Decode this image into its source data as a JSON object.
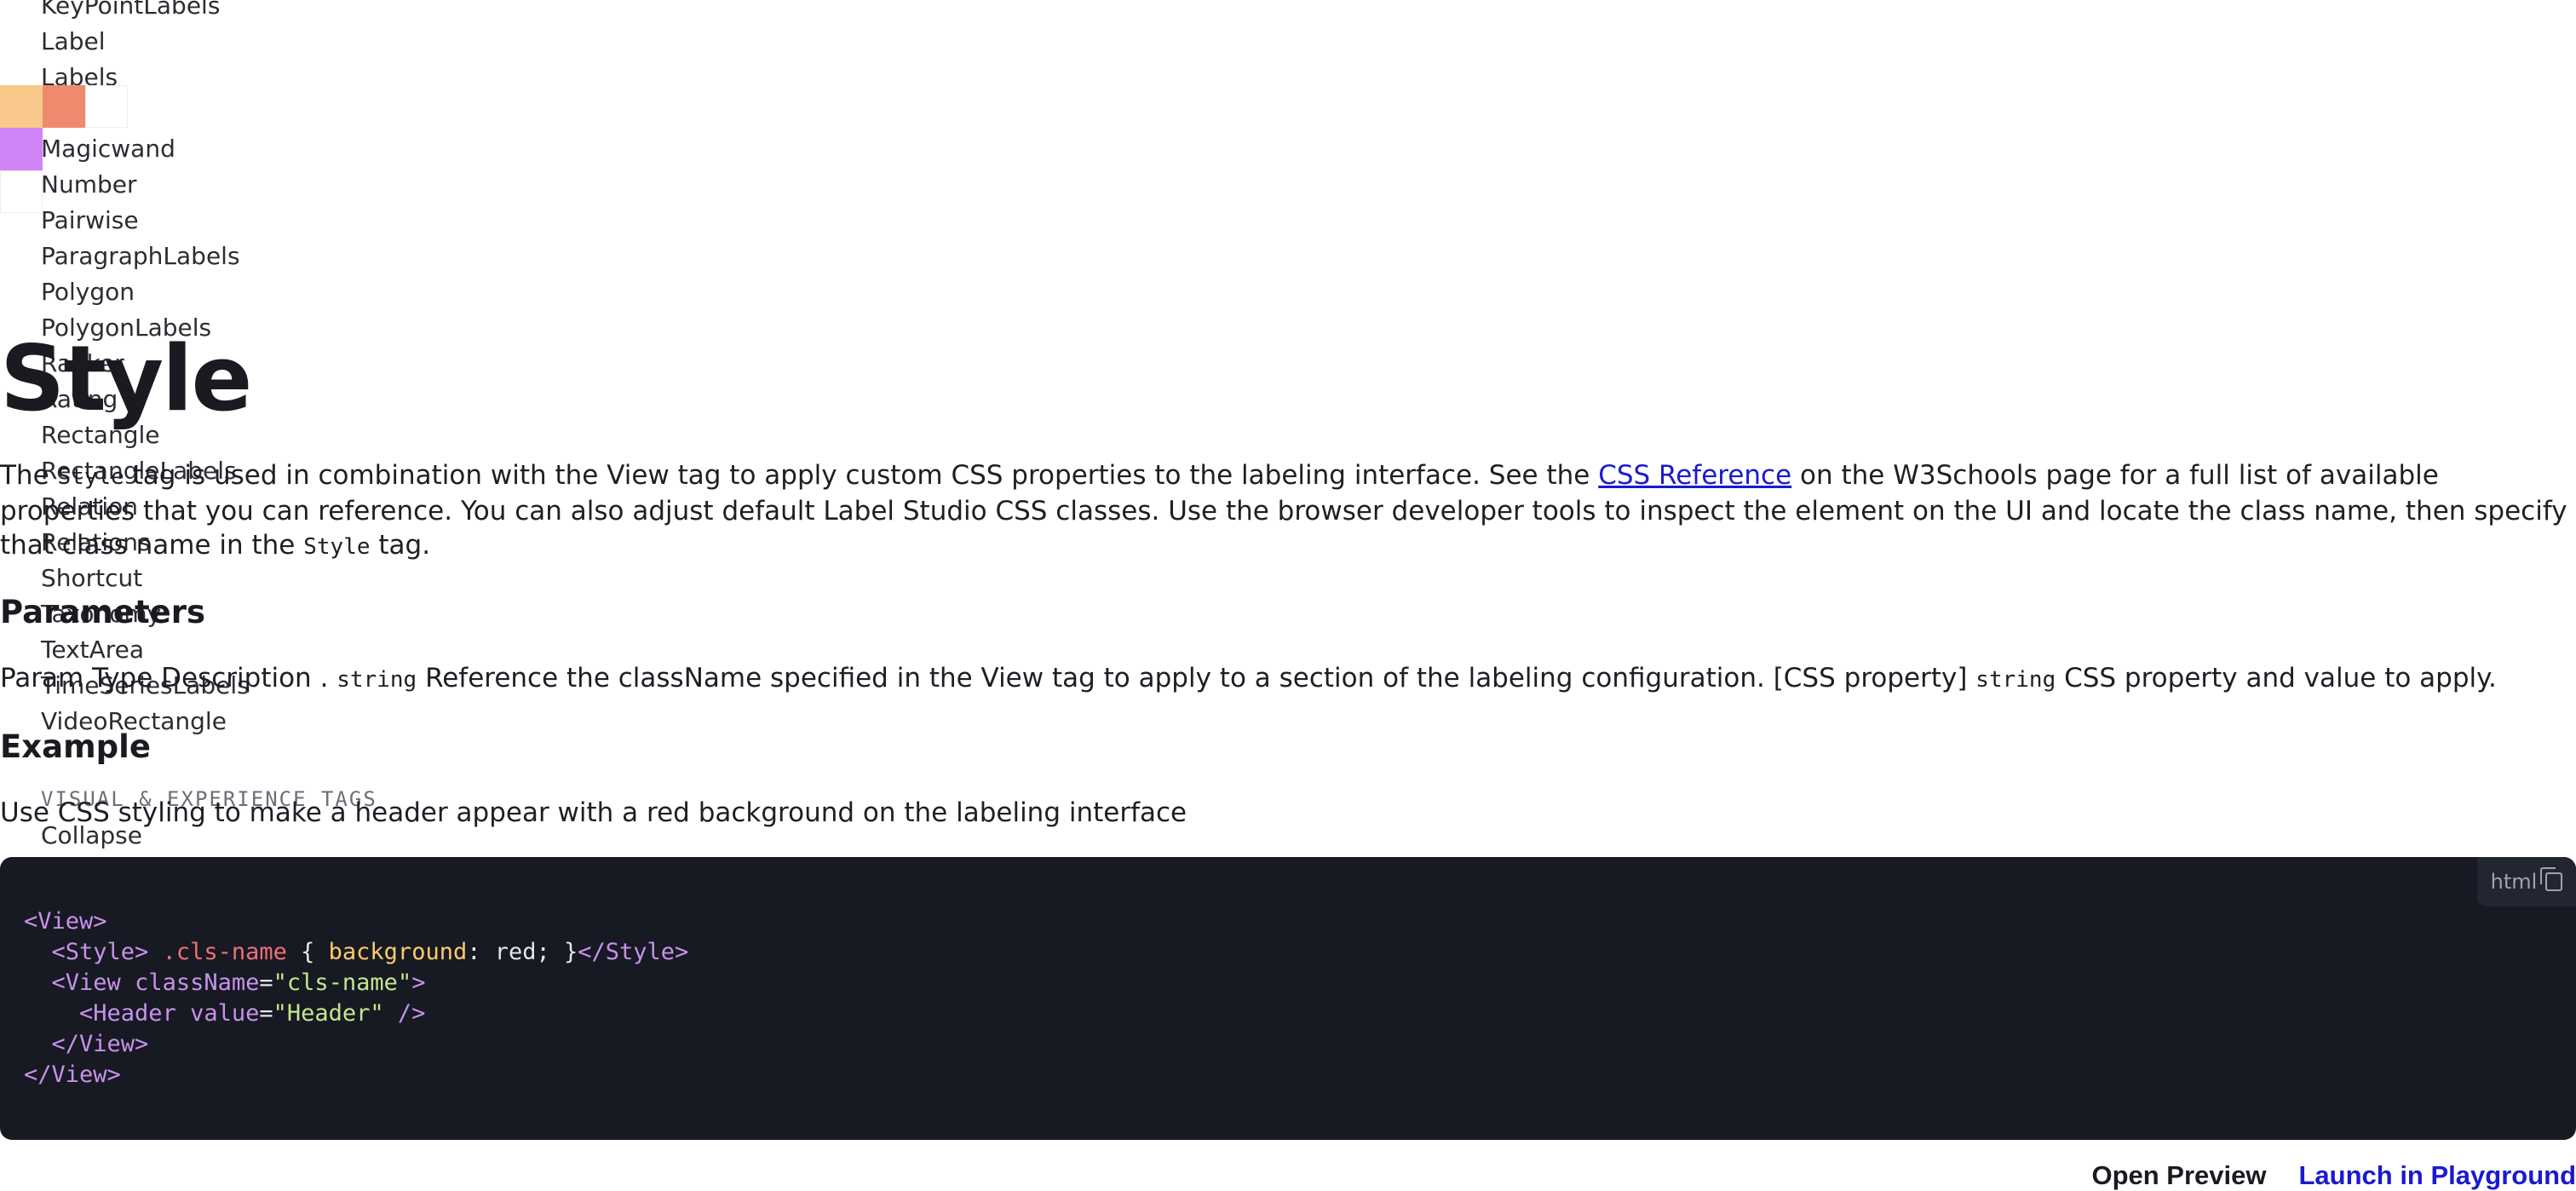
{
  "sidebar": {
    "items": [
      "KeyPointLabels",
      "Label",
      "Labels",
      "",
      "Magicwand",
      "Number",
      "Pairwise",
      "ParagraphLabels",
      "Polygon",
      "PolygonLabels",
      "Ranker",
      "Rating",
      "Rectangle",
      "RectangleLabels",
      "Relation",
      "Relations",
      "Shortcut",
      "Taxonomy",
      "TextArea",
      "TimeSeriesLabels",
      "VideoRectangle"
    ],
    "section_heading": "VISUAL & EXPERIENCE TAGS",
    "collapse_item": "Collapse"
  },
  "swatch_colors": [
    "#f8c98a",
    "#f08a6e",
    "#ffffff",
    "#cf85f5",
    "#ffffff"
  ],
  "page": {
    "title": "Style",
    "intro_part1": "The ",
    "intro_code1": "Style",
    "intro_part2": " tag is used in combination with the View tag to apply custom CSS properties to the labeling interface. See the ",
    "intro_link": "CSS Reference",
    "intro_part3": " on the W3Schools page for a full list of available properties that you can reference. You can also adjust default Label Studio CSS classes. Use the browser developer tools to inspect the element on the UI and locate the class name, then specify that class name in the ",
    "intro_code2": "Style",
    "intro_part4": " tag.",
    "params_heading": "Parameters",
    "params_header": "Param Type Description",
    "param1_name": ".",
    "param1_type": "string",
    "param1_desc": "Reference the className specified in the View tag to apply to a section of the labeling configuration.",
    "param2_name": "[CSS property]",
    "param2_type": "string",
    "param2_desc": "CSS property and value to apply.",
    "example_heading": "Example",
    "example_desc": "Use CSS styling to make a header appear with a red background on the labeling interface"
  },
  "code": {
    "language": "html",
    "line1_open": "<View>",
    "line2_open": "<Style>",
    "line2_sel": " .cls-name",
    "line2_brace_open": " { ",
    "line2_prop": "background",
    "line2_val": ": red; }",
    "line2_close": "</Style>",
    "line3_open": "<View ",
    "line3_attr": "className",
    "line3_eq": "=",
    "line3_str": "\"cls-name\"",
    "line3_end": ">",
    "line4_open": "<Header ",
    "line4_attr": "value",
    "line4_eq": "=",
    "line4_str": "\"Header\"",
    "line4_end": " />",
    "line5_close": "</View>",
    "line6_close": "</View>"
  },
  "actions": {
    "open_preview": "Open Preview",
    "launch_playground": "Launch in Playground"
  },
  "colors": {
    "link": "#1a1ad0",
    "code_bg": "#171923"
  }
}
